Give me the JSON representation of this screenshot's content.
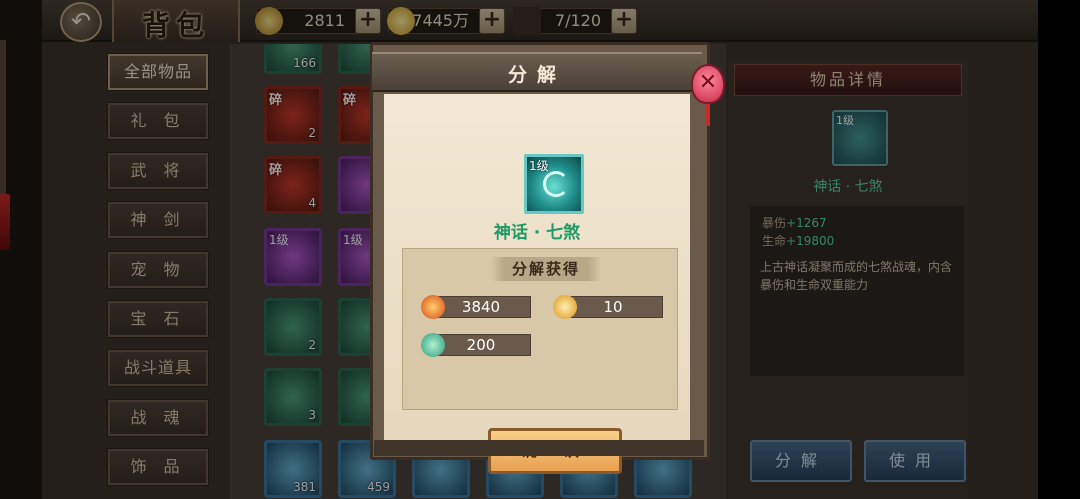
{
  "header": {
    "title": "背包",
    "back_icon": "↶",
    "resources": [
      {
        "icon": "ingot-icon",
        "value": "2811"
      },
      {
        "icon": "coin-icon",
        "value": "7445万"
      },
      {
        "icon": "bag-capacity-icon",
        "value": "7/120"
      }
    ],
    "plus": "+"
  },
  "menu": {
    "items": [
      "全部物品",
      "礼 包",
      "武 将",
      "神 剑",
      "宠 物",
      "宝 石",
      "战斗道具",
      "战 魂",
      "饰 品"
    ],
    "active_index": 0
  },
  "grid": {
    "frag_label": "碎",
    "level_label": "1级",
    "counts": [
      "166",
      "2",
      "4",
      "2",
      "3",
      "381",
      "459"
    ]
  },
  "detail": {
    "header": "物品详情",
    "icon_level": "1级",
    "item_name": "神话 · 七煞",
    "stats": [
      {
        "label": "暴伤",
        "value": "+1267"
      },
      {
        "label": "生命",
        "value": "+19800"
      }
    ],
    "description": "上古神话凝聚而成的七煞战魂，内含暴伤和生命双重能力",
    "buttons": [
      "分解",
      "使用"
    ]
  },
  "modal": {
    "title": "分解",
    "close_icon": "✕",
    "item_level": "1级",
    "item_name": "神话 · 七煞",
    "reward_title": "分解获得",
    "rewards": [
      {
        "icon": "soul-fire-icon",
        "value": "3840"
      },
      {
        "icon": "soul-crystal-icon",
        "value": "10"
      },
      {
        "icon": "jade-orb-icon",
        "value": "200"
      }
    ],
    "confirm_label": "确 认"
  },
  "colors": {
    "item_name_green": "#1e9a6a",
    "confirm_orange": "#e8a050",
    "close_red": "#c82a4a"
  }
}
